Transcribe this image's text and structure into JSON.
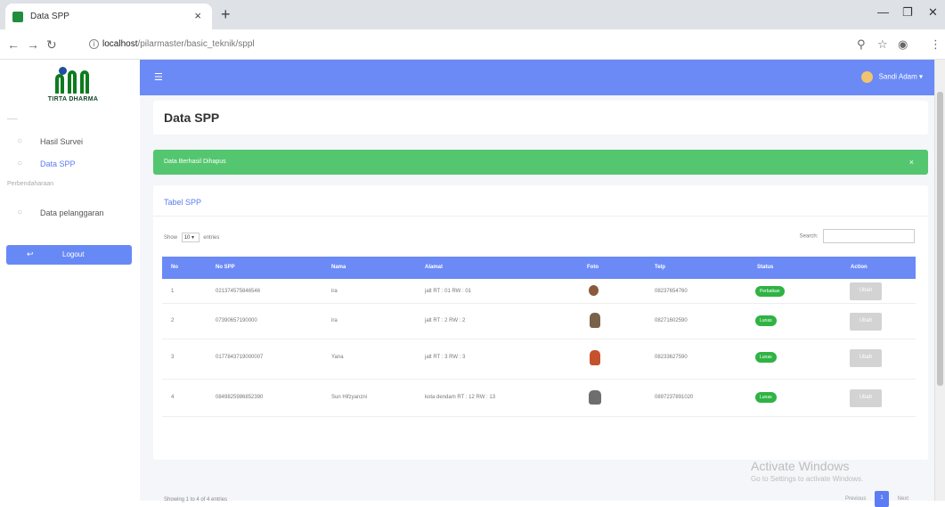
{
  "browser": {
    "tab_title": "Data SPP",
    "tab_close": "×",
    "new_tab": "+",
    "url_host": "localhost",
    "url_path": "/pilarmaster/basic_teknik/sppl"
  },
  "sidebar": {
    "logo_text": "TIRTA DHARMA",
    "heading_top": "___",
    "heading_master": "Perbendaharaan",
    "items": [
      {
        "label": "Hasil Survei",
        "icon": "circle-icon"
      },
      {
        "label": "Data SPP",
        "icon": "circle-icon"
      },
      {
        "label": "Data pelanggaran",
        "icon": "circle-icon"
      }
    ],
    "logout_label": "Logout"
  },
  "topbar": {
    "user_name": "Sandi Adam"
  },
  "page": {
    "title": "Data SPP",
    "alert_text": "Data Berhasil Dihapus",
    "alert_close": "×",
    "card_title": "Tabel SPP",
    "length_prefix": "Show",
    "length_value": "10",
    "length_suffix": "entries",
    "search_label": "Search:",
    "info": "Showing 1 to 4 of 4 entries",
    "pagination": {
      "previous": "Previous",
      "current": "1",
      "next": "Next"
    }
  },
  "table": {
    "headers": [
      "No",
      "No SPP",
      "Nama",
      "Alamat",
      "Foto",
      "Telp",
      "Status",
      "Action"
    ],
    "rows": [
      {
        "no": "1",
        "spp": "021374575846546",
        "nama": "ira",
        "alamat": "jalt RT : 01 RW : 01",
        "telp": "08237654760",
        "status": "Perbaikan",
        "action": "Ubah"
      },
      {
        "no": "2",
        "spp": "07390657190000",
        "nama": "ira",
        "alamat": "jalt RT : 2 RW : 2",
        "telp": "08271602590",
        "status": "Lunas",
        "action": "Ubah"
      },
      {
        "no": "3",
        "spp": "0177843719000007",
        "nama": "Yana",
        "alamat": "jalt RT : 3 RW : 3",
        "telp": "08233627590",
        "status": "Lunas",
        "action": "Ubah"
      },
      {
        "no": "4",
        "spp": "0849825986852390",
        "nama": "Sun Hifzyanzni",
        "alamat": "kota dendam RT : 12 RW : 13",
        "telp": "0897237891020",
        "status": "Lunas",
        "action": "Ubah"
      }
    ]
  },
  "watermark": {
    "line1": "Activate Windows",
    "line2": "Go to Settings to activate Windows."
  }
}
